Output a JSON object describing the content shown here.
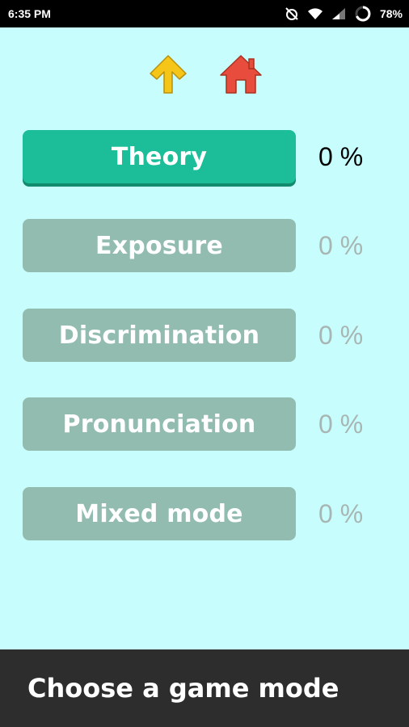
{
  "status_bar": {
    "time": "6:35 PM",
    "battery": "78%",
    "icons": [
      "alarm-off-icon",
      "wifi-icon",
      "signal-icon",
      "battery-ring-icon"
    ]
  },
  "nav": {
    "up_icon": "arrow-up-icon",
    "home_icon": "home-icon",
    "up_color": "#f5c518",
    "home_color": "#e84c3d"
  },
  "modes": [
    {
      "label": "Theory",
      "percent": "0 %",
      "active": true
    },
    {
      "label": "Exposure",
      "percent": "0 %",
      "active": false
    },
    {
      "label": "Discrimination",
      "percent": "0 %",
      "active": false
    },
    {
      "label": "Pronunciation",
      "percent": "0 %",
      "active": false
    },
    {
      "label": "Mixed mode",
      "percent": "0 %",
      "active": false
    }
  ],
  "footer": {
    "text": "Choose a game mode"
  },
  "colors": {
    "background": "#c8fdfd",
    "active_button": "#1bbe98",
    "inactive_button": "#93bcb1"
  }
}
